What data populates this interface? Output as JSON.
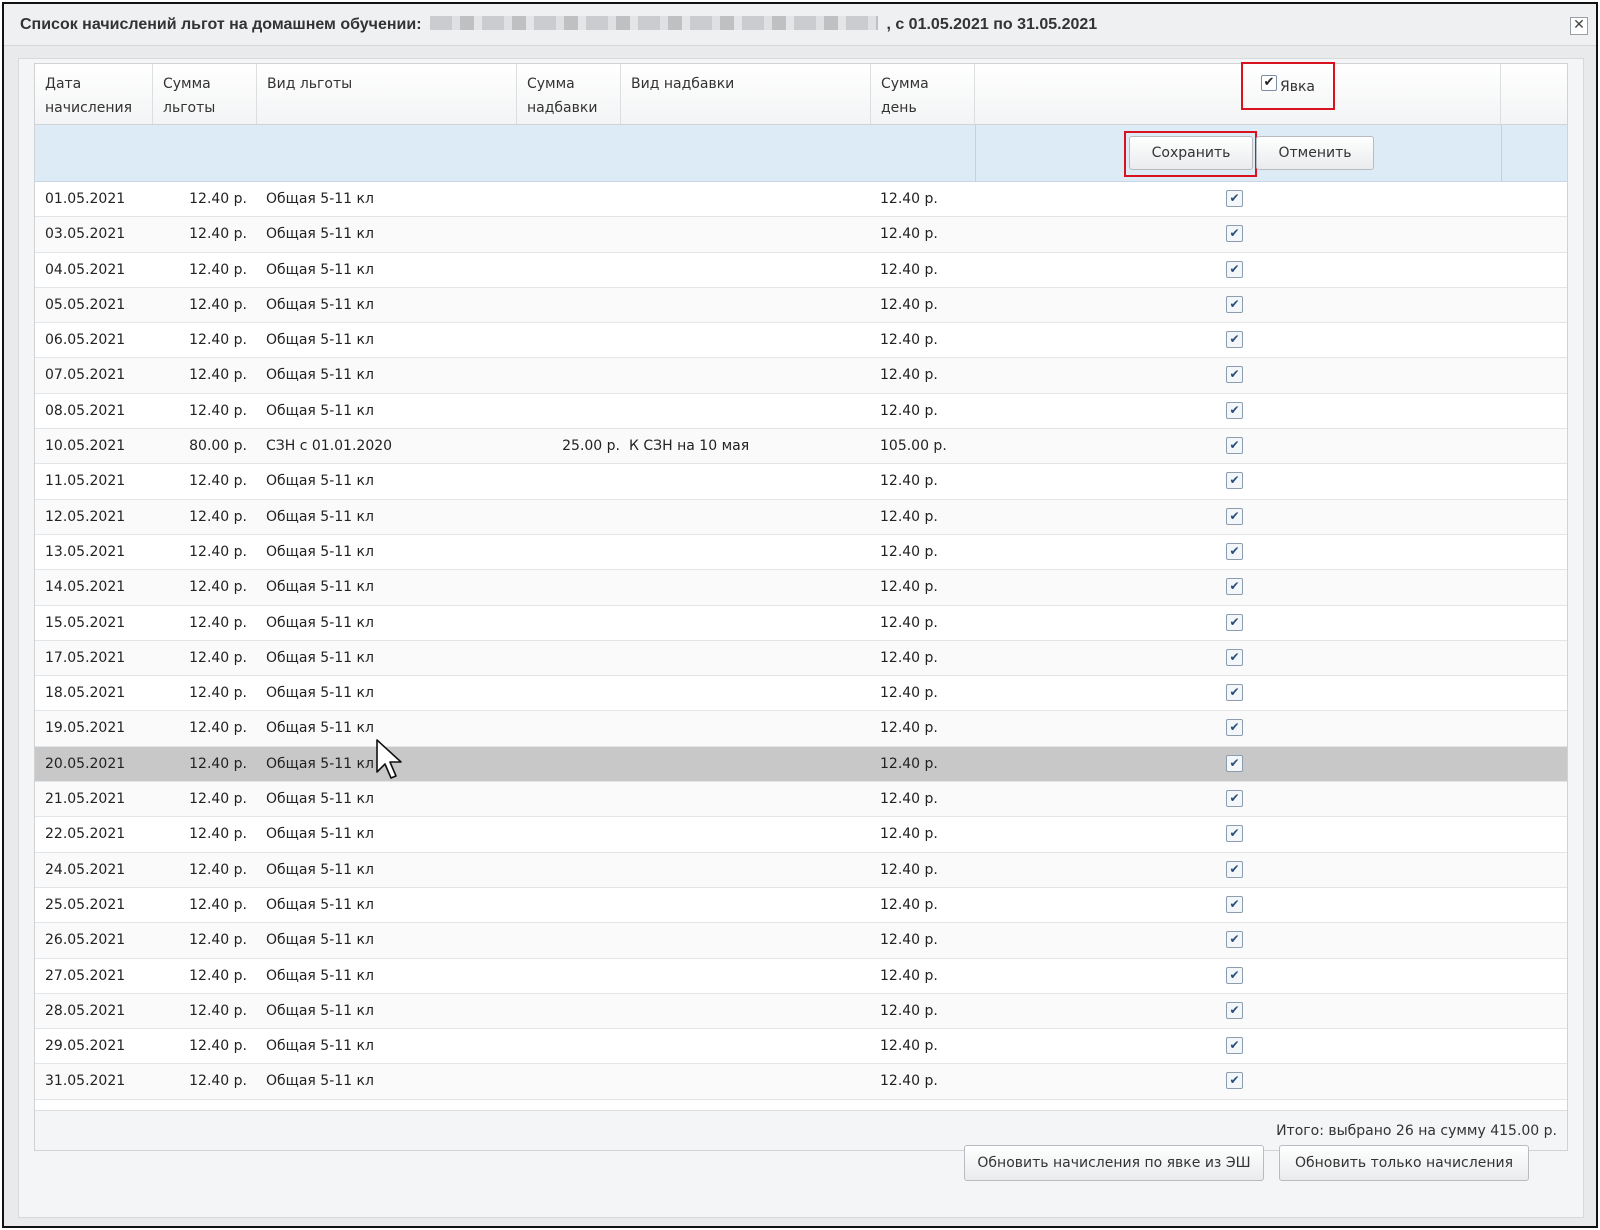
{
  "window": {
    "title_prefix": "Список начислений льгот на домашнем обучении:",
    "title_suffix": ", с 01.05.2021 по 31.05.2021",
    "close_glyph": "✕"
  },
  "columns": {
    "date": "Дата\nначисления",
    "benefit_sum": "Сумма\nльготы",
    "benefit_type": "Вид льготы",
    "bonus_sum": "Сумма\nнадбавки",
    "bonus_type": "Вид надбавки",
    "day_sum": "Сумма\nдень",
    "attendance": "Явка"
  },
  "editor": {
    "save_label": "Сохранить",
    "cancel_label": "Отменить"
  },
  "rows": [
    {
      "date": "01.05.2021",
      "sum": "12.40 р.",
      "type": "Общая 5-11 кл",
      "bonus": "",
      "bonus_type": "",
      "day": "12.40 р.",
      "checked": true
    },
    {
      "date": "03.05.2021",
      "sum": "12.40 р.",
      "type": "Общая 5-11 кл",
      "bonus": "",
      "bonus_type": "",
      "day": "12.40 р.",
      "checked": true
    },
    {
      "date": "04.05.2021",
      "sum": "12.40 р.",
      "type": "Общая 5-11 кл",
      "bonus": "",
      "bonus_type": "",
      "day": "12.40 р.",
      "checked": true
    },
    {
      "date": "05.05.2021",
      "sum": "12.40 р.",
      "type": "Общая 5-11 кл",
      "bonus": "",
      "bonus_type": "",
      "day": "12.40 р.",
      "checked": true
    },
    {
      "date": "06.05.2021",
      "sum": "12.40 р.",
      "type": "Общая 5-11 кл",
      "bonus": "",
      "bonus_type": "",
      "day": "12.40 р.",
      "checked": true
    },
    {
      "date": "07.05.2021",
      "sum": "12.40 р.",
      "type": "Общая 5-11 кл",
      "bonus": "",
      "bonus_type": "",
      "day": "12.40 р.",
      "checked": true
    },
    {
      "date": "08.05.2021",
      "sum": "12.40 р.",
      "type": "Общая 5-11 кл",
      "bonus": "",
      "bonus_type": "",
      "day": "12.40 р.",
      "checked": true
    },
    {
      "date": "10.05.2021",
      "sum": "80.00 р.",
      "type": "СЗН с 01.01.2020",
      "bonus": "25.00 р.",
      "bonus_type": "К СЗН на 10 мая",
      "day": "105.00 р.",
      "checked": true
    },
    {
      "date": "11.05.2021",
      "sum": "12.40 р.",
      "type": "Общая 5-11 кл",
      "bonus": "",
      "bonus_type": "",
      "day": "12.40 р.",
      "checked": true
    },
    {
      "date": "12.05.2021",
      "sum": "12.40 р.",
      "type": "Общая 5-11 кл",
      "bonus": "",
      "bonus_type": "",
      "day": "12.40 р.",
      "checked": true
    },
    {
      "date": "13.05.2021",
      "sum": "12.40 р.",
      "type": "Общая 5-11 кл",
      "bonus": "",
      "bonus_type": "",
      "day": "12.40 р.",
      "checked": true
    },
    {
      "date": "14.05.2021",
      "sum": "12.40 р.",
      "type": "Общая 5-11 кл",
      "bonus": "",
      "bonus_type": "",
      "day": "12.40 р.",
      "checked": true
    },
    {
      "date": "15.05.2021",
      "sum": "12.40 р.",
      "type": "Общая 5-11 кл",
      "bonus": "",
      "bonus_type": "",
      "day": "12.40 р.",
      "checked": true
    },
    {
      "date": "17.05.2021",
      "sum": "12.40 р.",
      "type": "Общая 5-11 кл",
      "bonus": "",
      "bonus_type": "",
      "day": "12.40 р.",
      "checked": true
    },
    {
      "date": "18.05.2021",
      "sum": "12.40 р.",
      "type": "Общая 5-11 кл",
      "bonus": "",
      "bonus_type": "",
      "day": "12.40 р.",
      "checked": true
    },
    {
      "date": "19.05.2021",
      "sum": "12.40 р.",
      "type": "Общая 5-11 кл",
      "bonus": "",
      "bonus_type": "",
      "day": "12.40 р.",
      "checked": true
    },
    {
      "date": "20.05.2021",
      "sum": "12.40 р.",
      "type": "Общая 5-11 кл",
      "bonus": "",
      "bonus_type": "",
      "day": "12.40 р.",
      "checked": true,
      "selected": true
    },
    {
      "date": "21.05.2021",
      "sum": "12.40 р.",
      "type": "Общая 5-11 кл",
      "bonus": "",
      "bonus_type": "",
      "day": "12.40 р.",
      "checked": true
    },
    {
      "date": "22.05.2021",
      "sum": "12.40 р.",
      "type": "Общая 5-11 кл",
      "bonus": "",
      "bonus_type": "",
      "day": "12.40 р.",
      "checked": true
    },
    {
      "date": "24.05.2021",
      "sum": "12.40 р.",
      "type": "Общая 5-11 кл",
      "bonus": "",
      "bonus_type": "",
      "day": "12.40 р.",
      "checked": true
    },
    {
      "date": "25.05.2021",
      "sum": "12.40 р.",
      "type": "Общая 5-11 кл",
      "bonus": "",
      "bonus_type": "",
      "day": "12.40 р.",
      "checked": true
    },
    {
      "date": "26.05.2021",
      "sum": "12.40 р.",
      "type": "Общая 5-11 кл",
      "bonus": "",
      "bonus_type": "",
      "day": "12.40 р.",
      "checked": true
    },
    {
      "date": "27.05.2021",
      "sum": "12.40 р.",
      "type": "Общая 5-11 кл",
      "bonus": "",
      "bonus_type": "",
      "day": "12.40 р.",
      "checked": true
    },
    {
      "date": "28.05.2021",
      "sum": "12.40 р.",
      "type": "Общая 5-11 кл",
      "bonus": "",
      "bonus_type": "",
      "day": "12.40 р.",
      "checked": true
    },
    {
      "date": "29.05.2021",
      "sum": "12.40 р.",
      "type": "Общая 5-11 кл",
      "bonus": "",
      "bonus_type": "",
      "day": "12.40 р.",
      "checked": true
    },
    {
      "date": "31.05.2021",
      "sum": "12.40 р.",
      "type": "Общая 5-11 кл",
      "bonus": "",
      "bonus_type": "",
      "day": "12.40 р.",
      "checked": true
    }
  ],
  "summary": "Итого: выбрано 26 на сумму 415.00 р.",
  "actions": {
    "update_from_attendance": "Обновить начисления по явке из ЭШ",
    "update_only": "Обновить только начисления"
  },
  "icons": {
    "checkmark": "✔",
    "cursor": "arrow-cursor"
  },
  "colors": {
    "highlight_outline": "#d9121f",
    "editor_row_bg": "#dcebf5",
    "selected_row_bg": "#c8c8c8"
  }
}
